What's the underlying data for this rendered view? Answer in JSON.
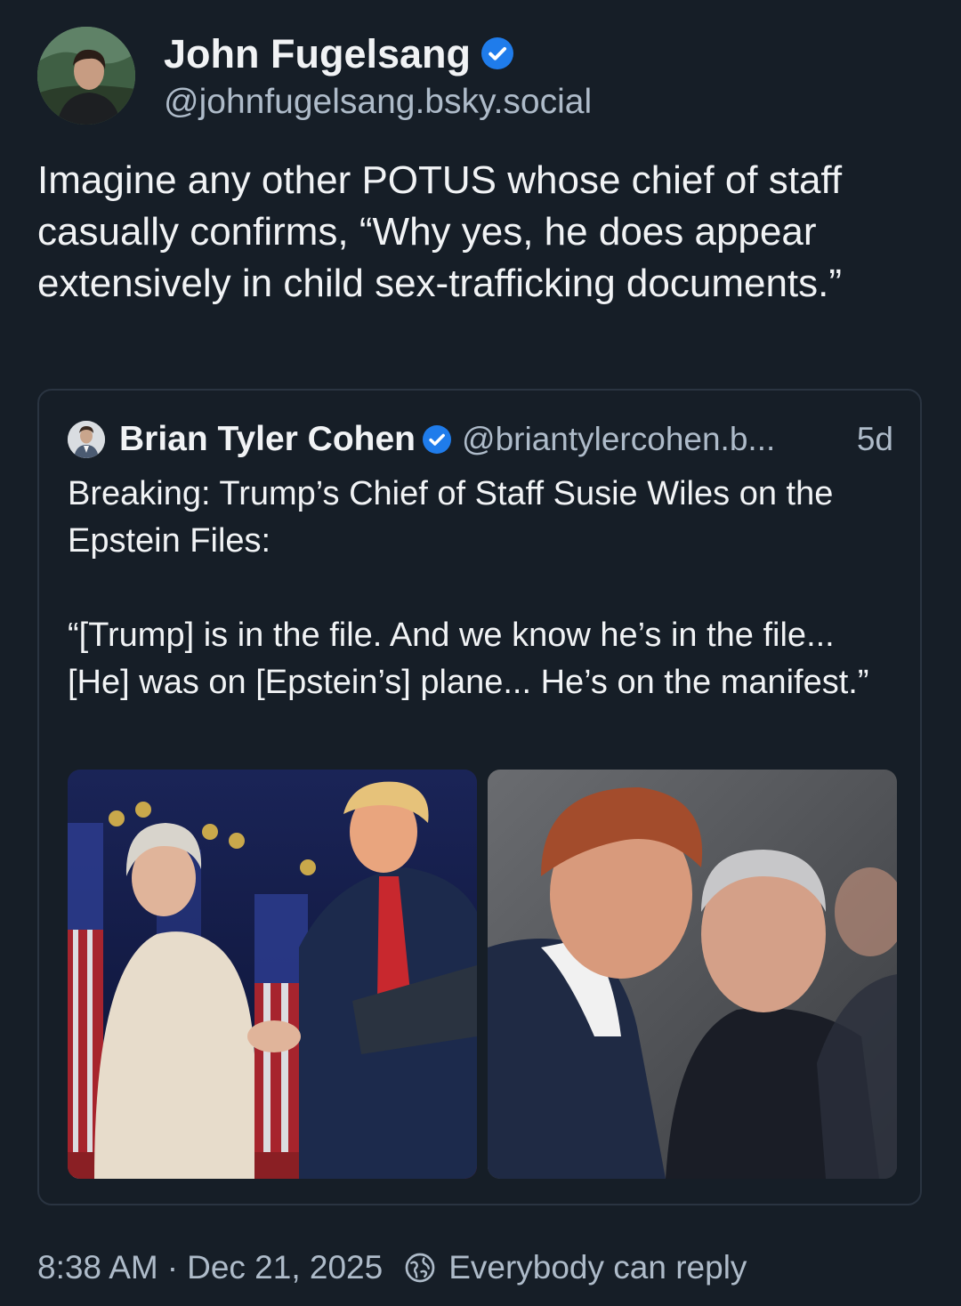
{
  "post": {
    "author": {
      "name": "John Fugelsang",
      "handle": "@johnfugelsang.bsky.social",
      "verified": true,
      "avatar_icon": "author-avatar-photo"
    },
    "text": "Imagine any other POTUS whose chief of staff casually confirms, “Why yes, he does appear extensively in child sex-trafficking documents.”",
    "quote": {
      "author_name": "Brian Tyler Cohen",
      "author_handle": "@briantylercohen.b...",
      "verified": true,
      "time": "5d",
      "text": "Breaking: Trump’s Chief of Staff Susie Wiles on the Epstein Files:\n\n“[Trump] is in the file. And we know he’s in the file... [He] was on [Epstein’s] plane... He’s on the manifest.”",
      "images": [
        {
          "icon": "photo-handshake-stage"
        },
        {
          "icon": "photo-two-men-event"
        }
      ]
    },
    "footer": {
      "time": "8:38 AM",
      "separator": "·",
      "date": "Dec 21, 2025",
      "reply_setting": "Everybody can reply",
      "reply_icon": "globe-icon"
    }
  },
  "colors": {
    "background": "#161e27",
    "text": "#f1f3f5",
    "muted": "#aebbc9",
    "verified": "#1f7ceb",
    "border": "#2a3441"
  }
}
